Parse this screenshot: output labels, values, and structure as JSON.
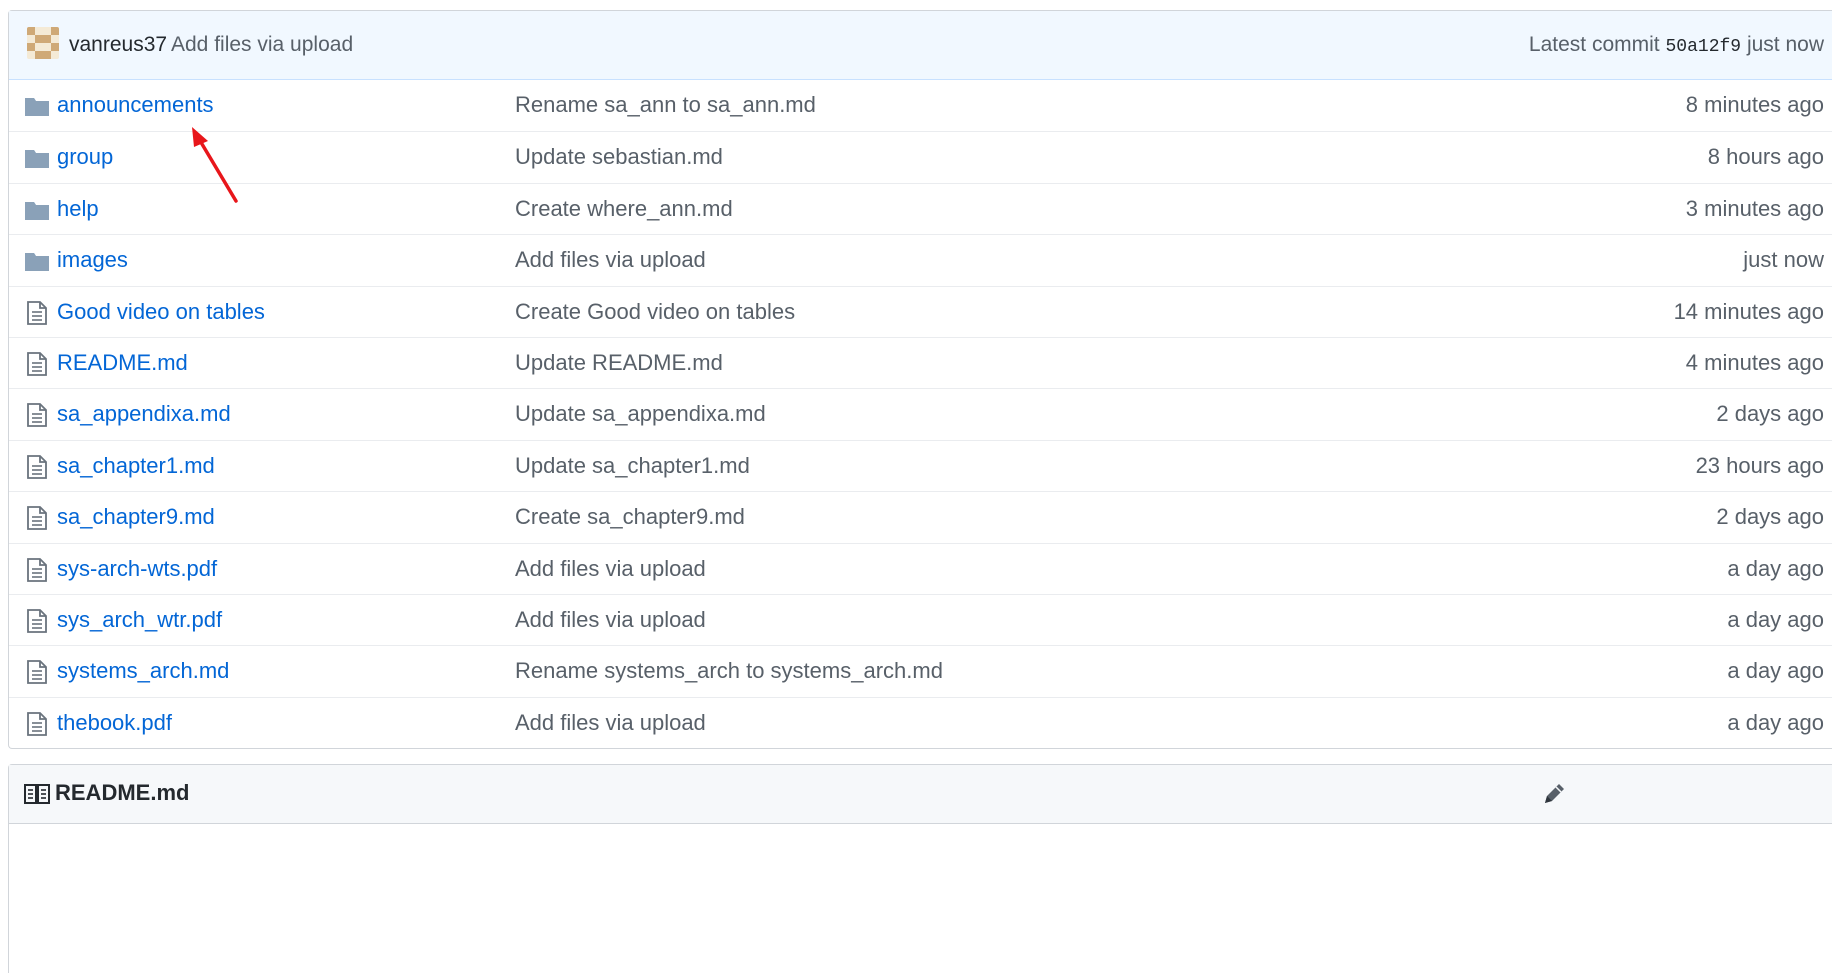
{
  "commit": {
    "author": "vanreus37",
    "message": "Add files via upload",
    "latest_label": "Latest commit",
    "sha": "50a12f9",
    "time": "just now"
  },
  "files": [
    {
      "name": "announcements",
      "type": "folder",
      "message": "Rename sa_ann to sa_ann.md",
      "age": "8 minutes ago"
    },
    {
      "name": "group",
      "type": "folder",
      "message": "Update sebastian.md",
      "age": "8 hours ago"
    },
    {
      "name": "help",
      "type": "folder",
      "message": "Create where_ann.md",
      "age": "3 minutes ago"
    },
    {
      "name": "images",
      "type": "folder",
      "message": "Add files via upload",
      "age": "just now"
    },
    {
      "name": "Good video on tables",
      "type": "file",
      "message": "Create Good video on tables",
      "age": "14 minutes ago"
    },
    {
      "name": "README.md",
      "type": "file",
      "message": "Update README.md",
      "age": "4 minutes ago"
    },
    {
      "name": "sa_appendixa.md",
      "type": "file",
      "message": "Update sa_appendixa.md",
      "age": "2 days ago"
    },
    {
      "name": "sa_chapter1.md",
      "type": "file",
      "message": "Update sa_chapter1.md",
      "age": "23 hours ago"
    },
    {
      "name": "sa_chapter9.md",
      "type": "file",
      "message": "Create sa_chapter9.md",
      "age": "2 days ago"
    },
    {
      "name": "sys-arch-wts.pdf",
      "type": "file",
      "message": "Add files via upload",
      "age": "a day ago"
    },
    {
      "name": "sys_arch_wtr.pdf",
      "type": "file",
      "message": "Add files via upload",
      "age": "a day ago"
    },
    {
      "name": "systems_arch.md",
      "type": "file",
      "message": "Rename systems_arch to systems_arch.md",
      "age": "a day ago"
    },
    {
      "name": "thebook.pdf",
      "type": "file",
      "message": "Add files via upload",
      "age": "a day ago"
    }
  ],
  "readme": {
    "title": "README.md",
    "icon": "book-icon",
    "edit_icon": "pencil-icon"
  },
  "colors": {
    "link": "#0366d6",
    "muted": "#586069",
    "folder_icon": "#79b8ff",
    "annotation_arrow": "#e8161b"
  }
}
